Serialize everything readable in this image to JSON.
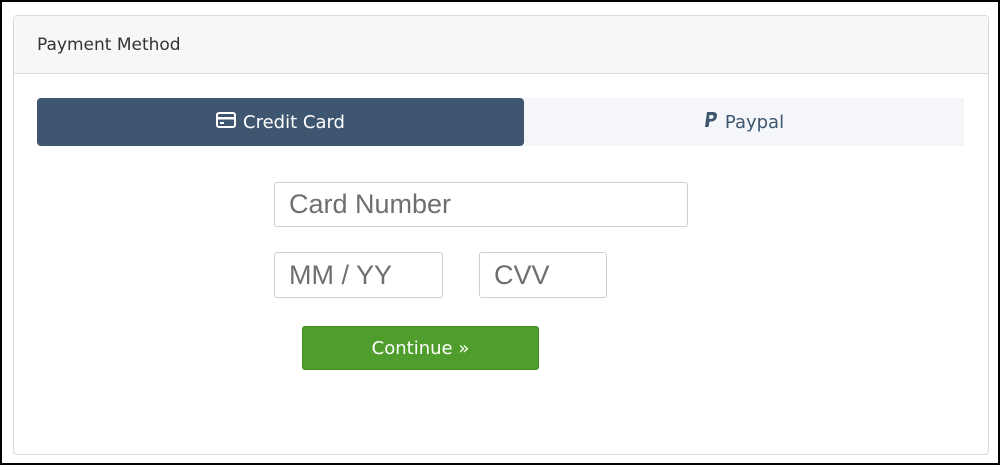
{
  "panel": {
    "title": "Payment Method"
  },
  "tabs": [
    {
      "label": "Credit Card",
      "icon": "credit-card-icon",
      "active": true
    },
    {
      "label": "Paypal",
      "icon": "paypal-icon",
      "active": false
    }
  ],
  "form": {
    "card_number": {
      "value": "",
      "placeholder": "Card Number"
    },
    "expiry": {
      "value": "",
      "placeholder": "MM / YY"
    },
    "cvv": {
      "value": "",
      "placeholder": "CVV"
    },
    "continue_label": "Continue »"
  },
  "colors": {
    "active_tab": "#3e5670",
    "inactive_tab": "#f4f6f9",
    "continue_button": "#4e9d2d"
  }
}
